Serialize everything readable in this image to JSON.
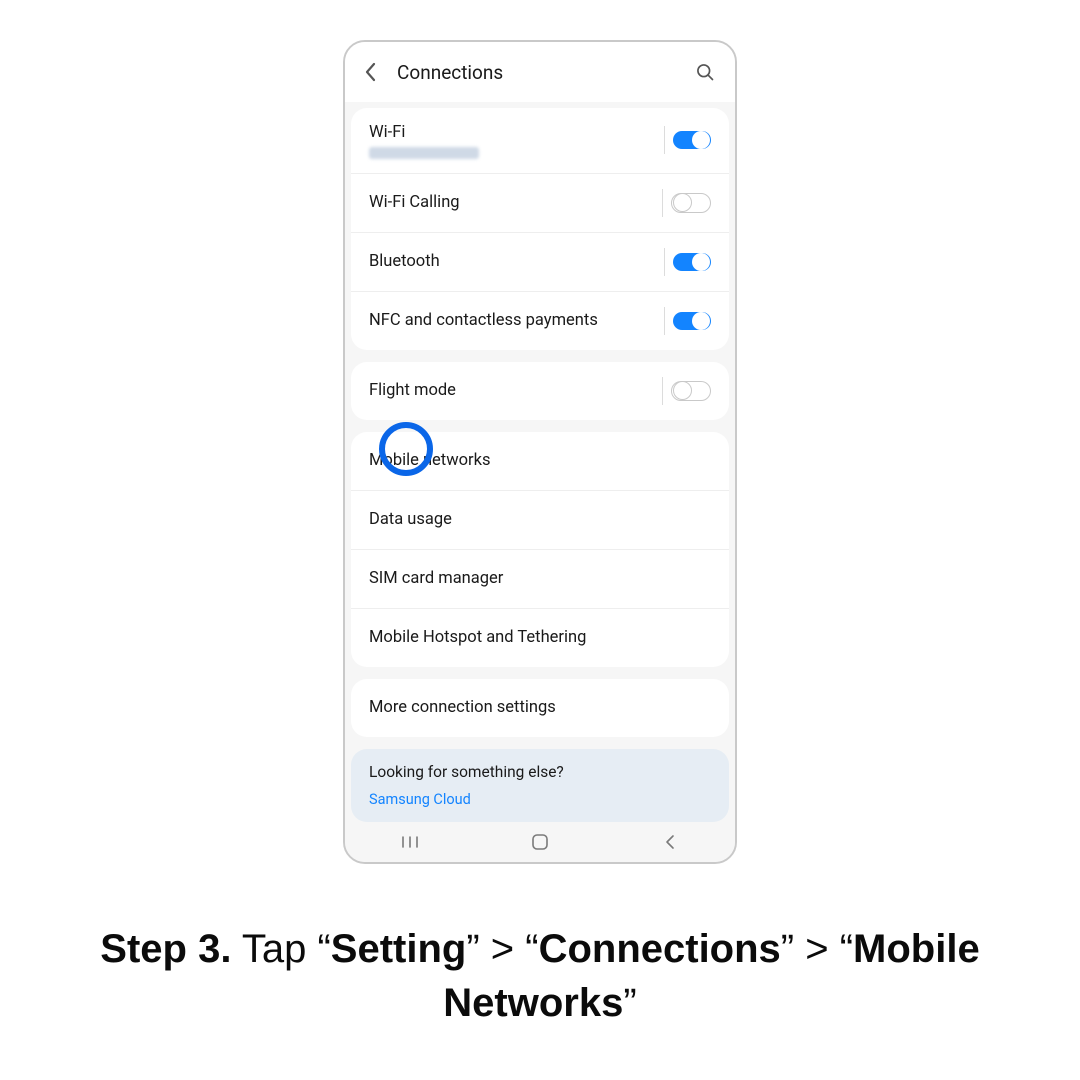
{
  "header": {
    "title": "Connections"
  },
  "groups": [
    {
      "id": "g1",
      "rows": [
        {
          "id": "wifi",
          "label": "Wi-Fi",
          "toggle": "on",
          "hasBlurSub": true
        },
        {
          "id": "wifi-calling",
          "label": "Wi-Fi Calling",
          "toggle": "off"
        },
        {
          "id": "bluetooth",
          "label": "Bluetooth",
          "toggle": "on"
        },
        {
          "id": "nfc",
          "label": "NFC and contactless payments",
          "toggle": "on"
        }
      ]
    },
    {
      "id": "g2",
      "rows": [
        {
          "id": "flight-mode",
          "label": "Flight mode",
          "toggle": "off"
        }
      ]
    },
    {
      "id": "g3",
      "rows": [
        {
          "id": "mobile-networks",
          "label": "Mobile networks"
        },
        {
          "id": "data-usage",
          "label": "Data usage"
        },
        {
          "id": "sim-manager",
          "label": "SIM card manager"
        },
        {
          "id": "hotspot",
          "label": "Mobile Hotspot and Tethering"
        }
      ]
    },
    {
      "id": "g4",
      "rows": [
        {
          "id": "more-settings",
          "label": "More connection settings"
        }
      ]
    }
  ],
  "footer": {
    "question": "Looking for something else?",
    "link": "Samsung Cloud"
  },
  "caption": {
    "step_bold": "Step 3.",
    "rest1": " Tap “",
    "word1": "Setting",
    "rest2": "” >  “",
    "word2": "Connections",
    "rest3": "” > “",
    "word3": "Mobile Networks",
    "rest4": "”"
  },
  "highlight_row_id": "mobile-networks"
}
